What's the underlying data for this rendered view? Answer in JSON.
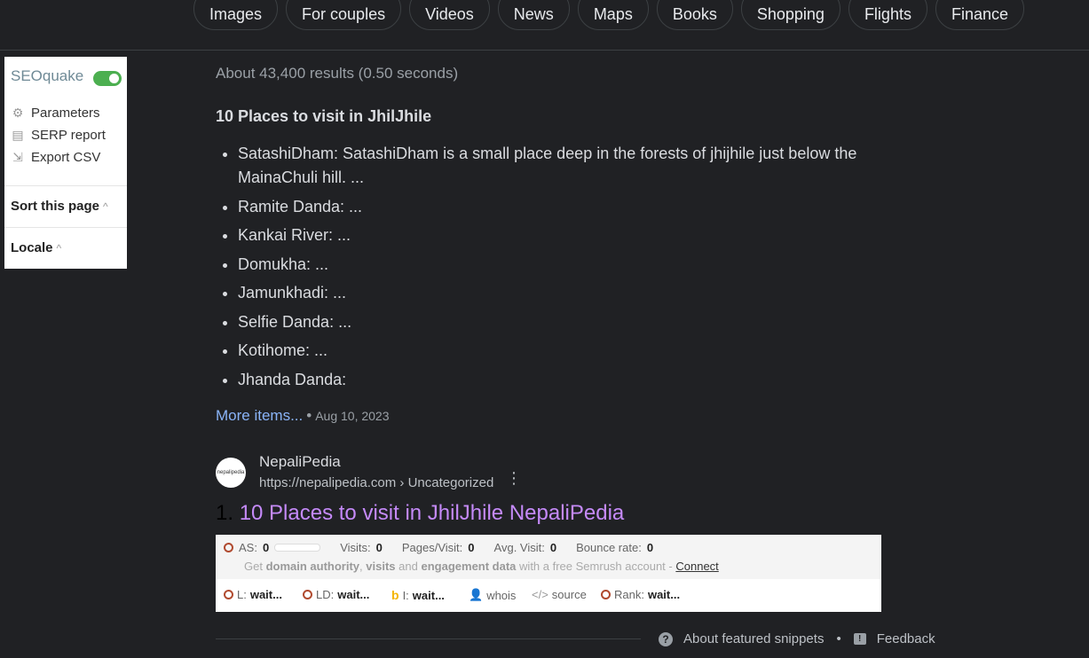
{
  "tabs": [
    "Images",
    "For couples",
    "Videos",
    "News",
    "Maps",
    "Books",
    "Shopping",
    "Flights",
    "Finance"
  ],
  "seoquake": {
    "title": "SEOquake",
    "toggle_on": true,
    "items": [
      {
        "label": "Parameters",
        "icon": "gear-icon"
      },
      {
        "label": "SERP report",
        "icon": "report-icon"
      },
      {
        "label": "Export CSV",
        "icon": "export-icon"
      }
    ],
    "sort_label": "Sort this page",
    "locale_label": "Locale"
  },
  "results": {
    "stats": "About 43,400 results (0.50 seconds)",
    "snippet_title": "10 Places to visit in JhilJhile",
    "snippet_items": [
      "SatashiDham: SatashiDham is a small place deep in the forests of jhijhile just below the MainaChuli hill. ...",
      "Ramite Danda: ...",
      "Kankai River: ...",
      "Domukha: ...",
      "Jamunkhadi: ...",
      "Selfie Danda: ...",
      "Kotihome: ...",
      "Jhanda Danda:"
    ],
    "more_items": "More items...",
    "date": "Aug 10, 2023",
    "site_name": "NepaliPedia",
    "site_url": "https://nepalipedia.com › Uncategorized",
    "result_number": "1.",
    "result_title": "10 Places to visit in JhilJhile NepaliPedia"
  },
  "semrush": {
    "as_label": "AS:",
    "as_value": "0",
    "visits_label": "Visits:",
    "visits_value": "0",
    "pages_label": "Pages/Visit:",
    "pages_value": "0",
    "avg_label": "Avg. Visit:",
    "avg_value": "0",
    "bounce_label": "Bounce rate:",
    "bounce_value": "0",
    "promo_get": "Get",
    "promo_da": "domain authority",
    "promo_sep": ",",
    "promo_visits": "visits",
    "promo_and": "and",
    "promo_ed": "engagement data",
    "promo_rest": "with a free Semrush account -",
    "connect": "Connect",
    "l_label": "L:",
    "l_value": "wait...",
    "ld_label": "LD:",
    "ld_value": "wait...",
    "i_label": "I:",
    "i_value": "wait...",
    "whois": "whois",
    "source": "source",
    "rank_label": "Rank:",
    "rank_value": "wait..."
  },
  "footer": {
    "about": "About featured snippets",
    "feedback": "Feedback"
  },
  "colors": {
    "background": "#202124",
    "link_blue": "#8ab4f8",
    "visited_purple": "#c58af9",
    "toggle_green": "#4caf50"
  }
}
